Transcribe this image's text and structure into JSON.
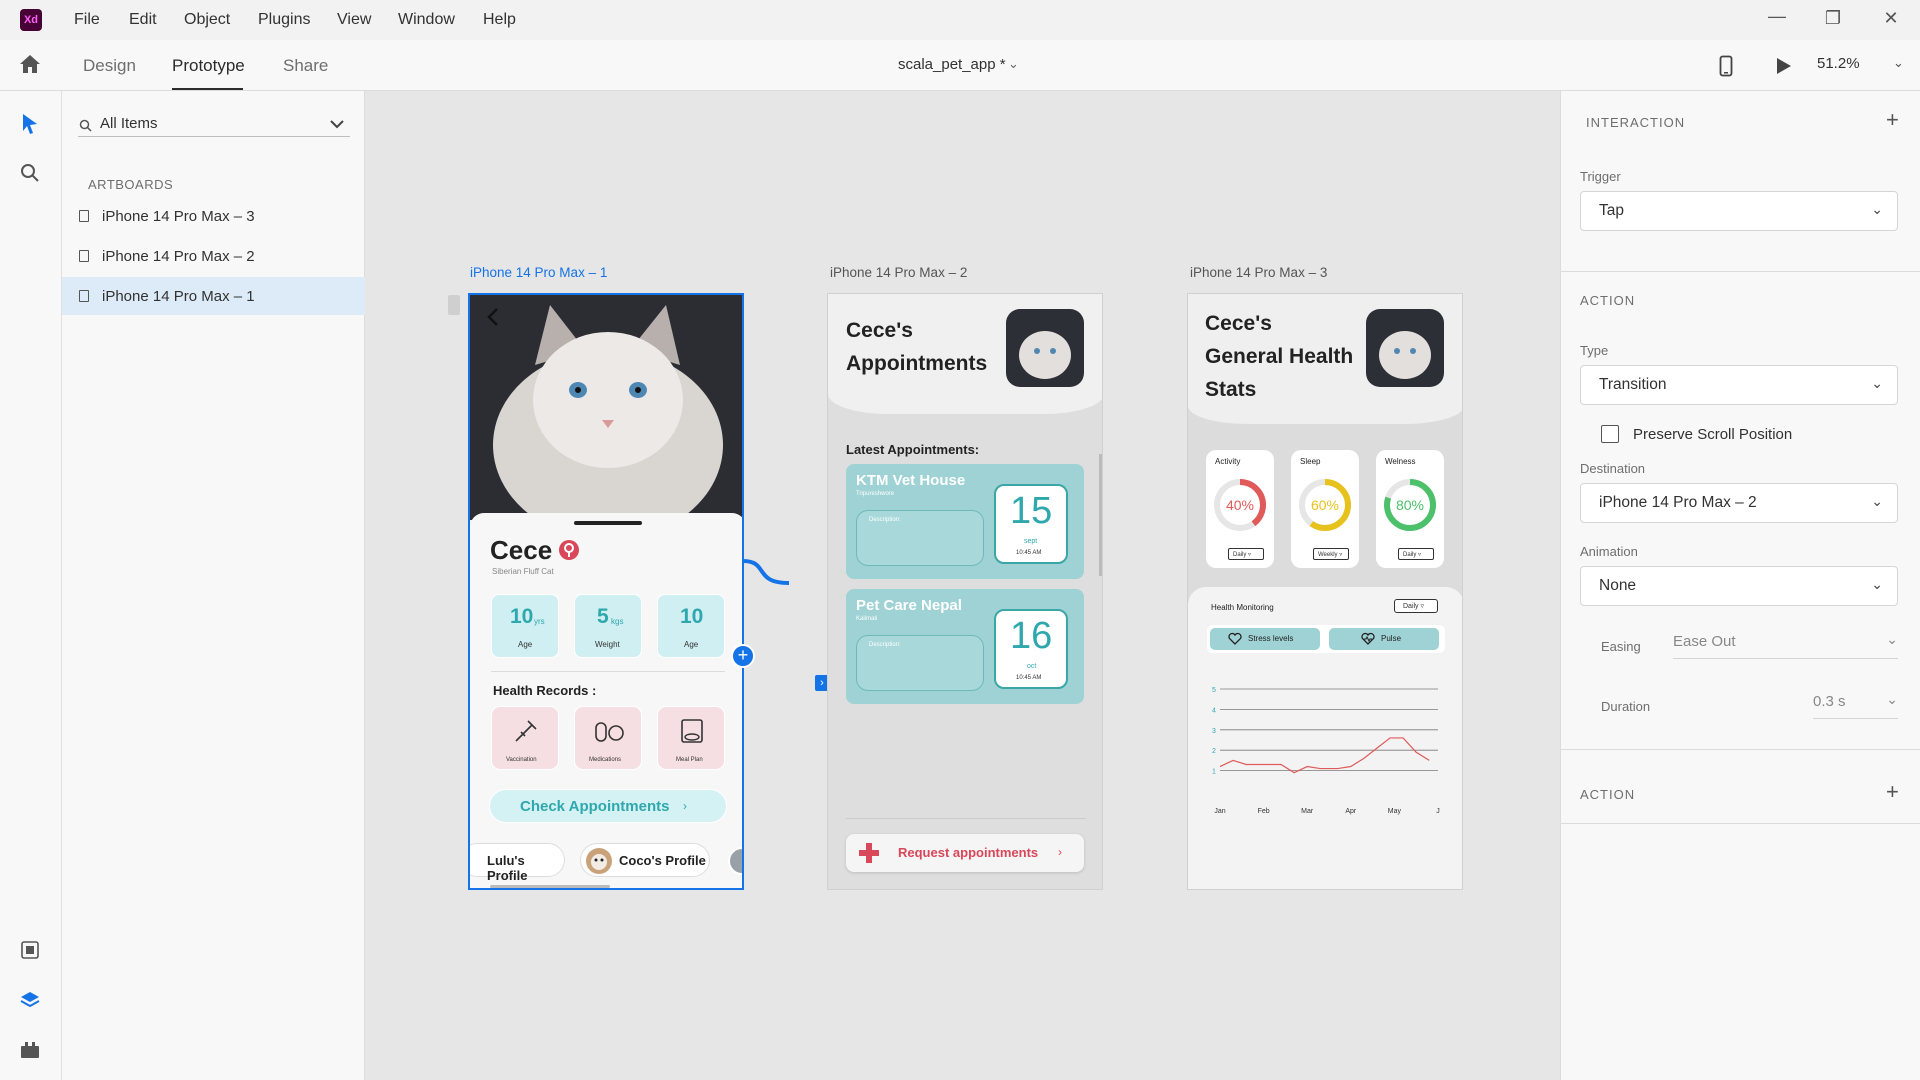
{
  "app": {
    "logo": "Xd",
    "doc_title": "scala_pet_app *",
    "zoom": "51.2%"
  },
  "menu": [
    "File",
    "Edit",
    "Object",
    "Plugins",
    "View",
    "Window",
    "Help"
  ],
  "modes": [
    "Design",
    "Prototype",
    "Share"
  ],
  "layers": {
    "search_value": "All Items",
    "section": "ARTBOARDS",
    "artboards": [
      "iPhone 14 Pro Max – 3",
      "iPhone 14 Pro Max – 2",
      "iPhone 14 Pro Max – 1"
    ]
  },
  "artboard_titles": [
    "iPhone 14 Pro Max – 1",
    "iPhone 14 Pro Max – 2",
    "iPhone 14 Pro Max – 3"
  ],
  "profile": {
    "name": "Cece",
    "breed": "Siberian Fluff Cat",
    "stats": [
      {
        "value": "10",
        "unit": "yrs",
        "label": "Age"
      },
      {
        "value": "5",
        "unit": "kgs",
        "label": "Weight"
      },
      {
        "value": "10",
        "unit": "",
        "label": "Age"
      }
    ],
    "records_heading": "Health Records :",
    "records": [
      "Vaccination",
      "Medications",
      "Meal Plan"
    ],
    "cta": "Check Appointments",
    "friends": [
      "Lulu's Profile",
      "Coco's Profile"
    ]
  },
  "appointments": {
    "title_1": "Cece's",
    "title_2": "Appointments",
    "heading": "Latest Appointments:",
    "items": [
      {
        "place": "KTM Vet House",
        "area": "Tripureshwore",
        "desc": "Description:",
        "day": "15",
        "month": "sept",
        "time": "10:45 AM"
      },
      {
        "place": "Pet Care Nepal",
        "area": "Kalimati",
        "desc": "Description:",
        "day": "16",
        "month": "oct",
        "time": "10:45 AM"
      }
    ],
    "request": "Request appointments"
  },
  "stats": {
    "title_1": "Cece's",
    "title_2": "General Health",
    "title_3": "Stats",
    "rings": [
      {
        "label": "Activity",
        "value": "40%",
        "fraction": 0.4,
        "color": "#e05a5a",
        "period": "Daily"
      },
      {
        "label": "Sleep",
        "value": "60%",
        "fraction": 0.6,
        "color": "#e8c21c",
        "period": "Weekly"
      },
      {
        "label": "Welness",
        "value": "80%",
        "fraction": 0.8,
        "color": "#4cc06a",
        "period": "Daily"
      }
    ],
    "monitor_title": "Health Monitoring",
    "monitor_period": "Daily",
    "tabs": [
      "Stress levels",
      "Pulse"
    ]
  },
  "chart_data": {
    "type": "line",
    "categories": [
      "Jan",
      "Feb",
      "Mar",
      "Apr",
      "May",
      "J"
    ],
    "yticks": [
      1,
      2,
      3,
      4,
      5
    ],
    "ylim": [
      0,
      5
    ],
    "x": [
      0,
      0.3,
      0.6,
      1,
      1.4,
      1.7,
      2,
      2.3,
      2.7,
      3,
      3.3,
      3.6,
      3.9,
      4.2,
      4.5,
      4.8
    ],
    "values": [
      1.2,
      1.5,
      1.3,
      1.3,
      1.3,
      0.9,
      1.2,
      1.1,
      1.1,
      1.2,
      1.6,
      2.1,
      2.6,
      2.6,
      1.9,
      1.5
    ],
    "color": "#e05a5a",
    "grid": true
  },
  "interaction": {
    "header": "INTERACTION",
    "trigger_label": "Trigger",
    "trigger": "Tap",
    "action_header": "ACTION",
    "type_label": "Type",
    "type": "Transition",
    "preserve": "Preserve Scroll Position",
    "dest_label": "Destination",
    "destination": "iPhone 14 Pro Max – 2",
    "anim_label": "Animation",
    "animation": "None",
    "easing_label": "Easing",
    "easing": "Ease Out",
    "duration_label": "Duration",
    "duration": "0.3 s",
    "action2_header": "ACTION"
  }
}
